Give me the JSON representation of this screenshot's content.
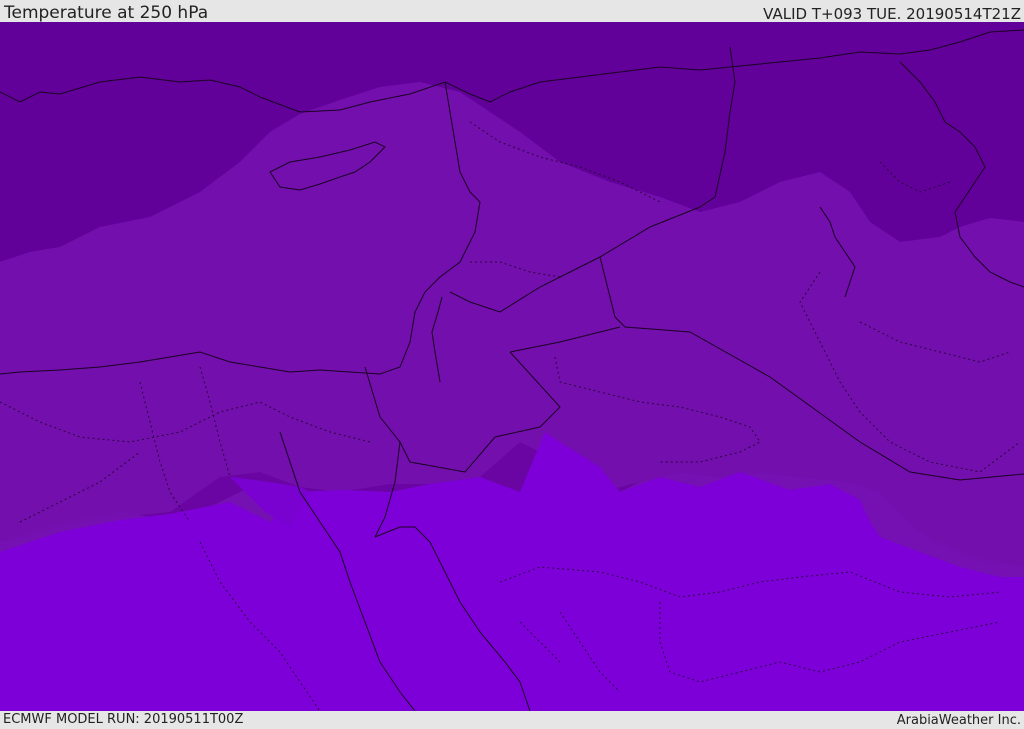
{
  "header": {
    "title": "Temperature at 250 hPa",
    "valid_time": "VALID T+093 TUE. 20190514T21Z"
  },
  "footer": {
    "model_run": "ECMWF MODEL RUN: 20190511T00Z",
    "credit": "ArabiaWeather Inc."
  },
  "map": {
    "colors": {
      "coldest": "#62009a",
      "cold": "#6a05a4",
      "mid": "#7510b2",
      "warm": "#780fc0",
      "warmer": "#7e00d8",
      "border": "#1a0022"
    }
  }
}
